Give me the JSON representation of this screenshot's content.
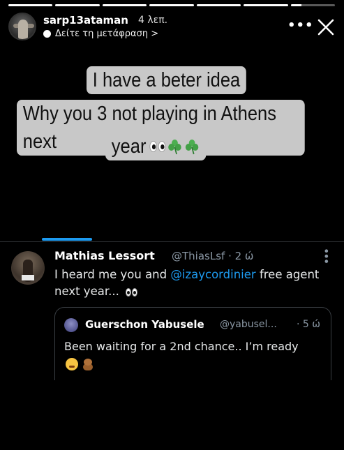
{
  "story": {
    "username": "sarp13ataman",
    "time": "4 λεπ.",
    "translate_label": "Δείτε τη μετάφραση >",
    "progress": [
      1,
      1,
      1,
      1,
      1,
      1,
      0.25
    ]
  },
  "sticker": {
    "line1": "I have a beter idea",
    "line2": "Why you 3 not playing in Athens next",
    "line3": "year"
  },
  "tweet": {
    "name": "Mathias Lessort",
    "handle": "@ThiasLsf · 2 ώ",
    "text_before": "I heard me you and ",
    "mention": "@izaycordinier",
    "text_after": " free agent next year..."
  },
  "quote": {
    "name": "Guerschon Yabusele",
    "handle": "@yabusel...",
    "time": "· 5 ώ",
    "text": "Been waiting for a 2nd chance.. I’m ready"
  },
  "colors": {
    "accent": "#1d9bf0",
    "sticker_bg": "#c8c8c8",
    "clover": "#4caf50"
  }
}
